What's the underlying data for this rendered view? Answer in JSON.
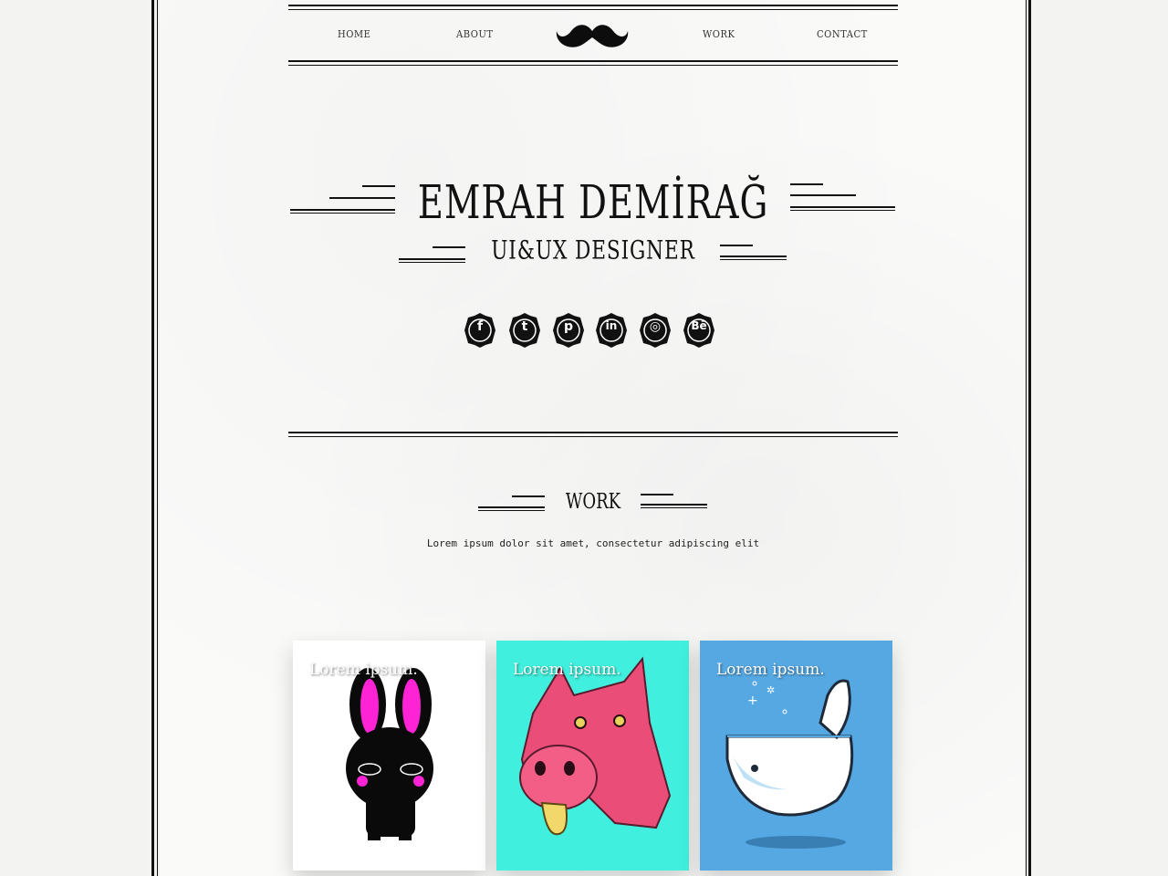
{
  "nav": {
    "items": [
      "HOME",
      "ABOUT",
      "WORK",
      "CONTACT"
    ],
    "logo_icon": "mustache-icon"
  },
  "hero": {
    "name": "EMRAH DEMİRAĞ",
    "title": "UI&UX DESIGNER"
  },
  "social": [
    {
      "name": "facebook-icon",
      "glyph": "f"
    },
    {
      "name": "twitter-icon",
      "glyph": "t"
    },
    {
      "name": "pinterest-icon",
      "glyph": "p"
    },
    {
      "name": "linkedin-icon",
      "glyph": "in"
    },
    {
      "name": "dribbble-icon",
      "glyph": "◎"
    },
    {
      "name": "behance-icon",
      "glyph": "Bē"
    }
  ],
  "work": {
    "heading": "WORK",
    "subtitle": "Lorem ipsum dolor sit amet, consectetur adipiscing elit",
    "cards": [
      {
        "label": "Lorem ipsum.",
        "bg": "#ffffff",
        "illustration": "black-rabbit"
      },
      {
        "label": "Lorem ipsum.",
        "bg": "#40efdd",
        "illustration": "pink-dog"
      },
      {
        "label": "Lorem ipsum.",
        "bg": "#56a8e3",
        "illustration": "whale"
      }
    ]
  }
}
